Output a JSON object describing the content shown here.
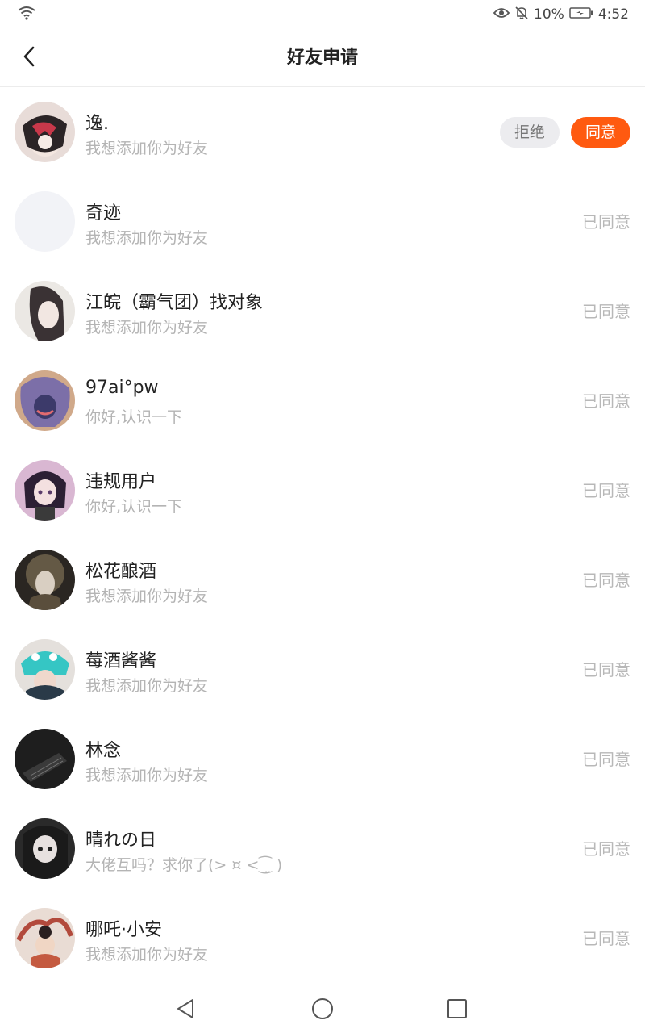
{
  "status_bar": {
    "battery": "10%",
    "time": "4:52",
    "icons": [
      "wifi-icon",
      "eye-icon",
      "bell-off-icon",
      "battery-icon"
    ]
  },
  "header": {
    "title": "好友申请",
    "back_icon": "chevron-left-icon"
  },
  "requests": [
    {
      "name": "逸.",
      "message": "我想添加你为好友",
      "status": "pending"
    },
    {
      "name": "奇迹",
      "message": "我想添加你为好友",
      "status": "已同意"
    },
    {
      "name": "江皖（霸气团）找对象",
      "message": "我想添加你为好友",
      "status": "已同意"
    },
    {
      "name": "97ai°pw",
      "message": "你好,认识一下",
      "status": "已同意"
    },
    {
      "name": "违规用户",
      "message": "你好,认识一下",
      "status": "已同意"
    },
    {
      "name": "松花酿酒",
      "message": "我想添加你为好友",
      "status": "已同意"
    },
    {
      "name": "莓酒酱酱",
      "message": "我想添加你为好友",
      "status": "已同意"
    },
    {
      "name": "林念",
      "message": "我想添加你为好友",
      "status": "已同意"
    },
    {
      "name": "晴れの日",
      "message": "大佬互吗？求你了(> ¤ <⁐̤ )",
      "status": "已同意"
    },
    {
      "name": "哪吒·小安",
      "message": "我想添加你为好友",
      "status": "已同意"
    }
  ],
  "actions": {
    "reject_label": "拒绝",
    "accept_label": "同意"
  },
  "colors": {
    "accent": "#ff5a10",
    "muted_text": "#b4b4b4",
    "reject_bg": "#ececef"
  },
  "nav_bar": {
    "icons": [
      "back-triangle-icon",
      "home-circle-icon",
      "recents-square-icon"
    ]
  }
}
